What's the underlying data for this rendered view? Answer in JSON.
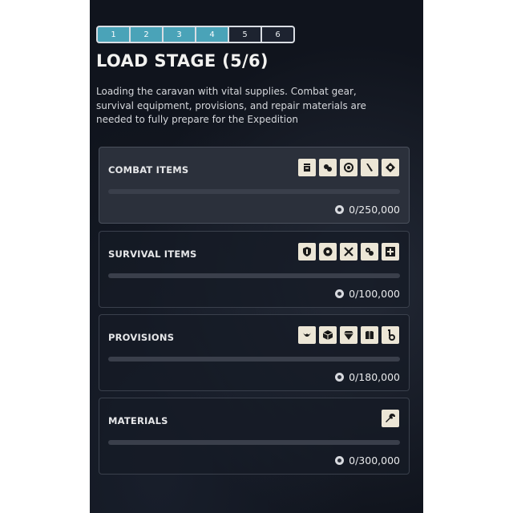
{
  "stepper": {
    "steps": [
      "1",
      "2",
      "3",
      "4",
      "5",
      "6"
    ],
    "completed": 4
  },
  "title": "LOAD STAGE (5/6)",
  "description": "Loading the caravan with vital supplies. Combat gear, survival equipment, provisions, and repair materials are needed to fully prepare for the Expedition",
  "categories": [
    {
      "name": "COMBAT ITEMS",
      "amount": "0/250,000",
      "progress": 0,
      "icons": [
        "grenade-icon",
        "ammo-icon",
        "target-icon",
        "blade-icon",
        "explosive-icon"
      ]
    },
    {
      "name": "SURVIVAL ITEMS",
      "amount": "0/100,000",
      "progress": 0,
      "icons": [
        "shield-icon",
        "gear-icon",
        "crossed-tools-icon",
        "bandage-icon",
        "medkit-icon"
      ]
    },
    {
      "name": "PROVISIONS",
      "amount": "0/180,000",
      "progress": 0,
      "icons": [
        "leaf-icon",
        "crate-icon",
        "gem-icon",
        "canteen-icon",
        "hook-icon"
      ]
    },
    {
      "name": "MATERIALS",
      "amount": "0/300,000",
      "progress": 0,
      "icons": [
        "wrench-icon"
      ]
    }
  ],
  "colors": {
    "step_done": "#4aa3b8",
    "icon_bg": "#ece6d6",
    "panel_bg": "#10141d"
  }
}
